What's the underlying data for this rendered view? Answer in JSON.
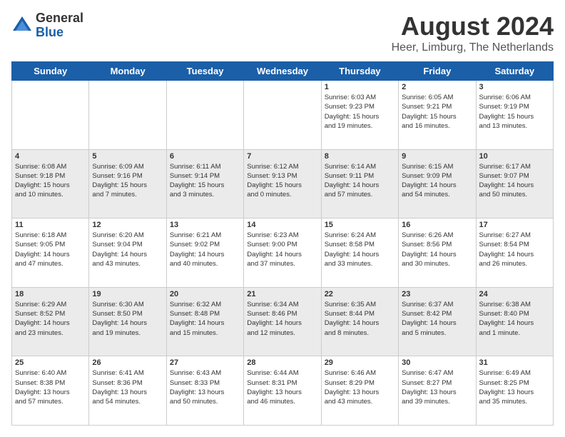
{
  "header": {
    "logo_general": "General",
    "logo_blue": "Blue",
    "month_title": "August 2024",
    "location": "Heer, Limburg, The Netherlands"
  },
  "weekdays": [
    "Sunday",
    "Monday",
    "Tuesday",
    "Wednesday",
    "Thursday",
    "Friday",
    "Saturday"
  ],
  "rows": [
    [
      {
        "day": "",
        "info": ""
      },
      {
        "day": "",
        "info": ""
      },
      {
        "day": "",
        "info": ""
      },
      {
        "day": "",
        "info": ""
      },
      {
        "day": "1",
        "info": "Sunrise: 6:03 AM\nSunset: 9:23 PM\nDaylight: 15 hours\nand 19 minutes."
      },
      {
        "day": "2",
        "info": "Sunrise: 6:05 AM\nSunset: 9:21 PM\nDaylight: 15 hours\nand 16 minutes."
      },
      {
        "day": "3",
        "info": "Sunrise: 6:06 AM\nSunset: 9:19 PM\nDaylight: 15 hours\nand 13 minutes."
      }
    ],
    [
      {
        "day": "4",
        "info": "Sunrise: 6:08 AM\nSunset: 9:18 PM\nDaylight: 15 hours\nand 10 minutes."
      },
      {
        "day": "5",
        "info": "Sunrise: 6:09 AM\nSunset: 9:16 PM\nDaylight: 15 hours\nand 7 minutes."
      },
      {
        "day": "6",
        "info": "Sunrise: 6:11 AM\nSunset: 9:14 PM\nDaylight: 15 hours\nand 3 minutes."
      },
      {
        "day": "7",
        "info": "Sunrise: 6:12 AM\nSunset: 9:13 PM\nDaylight: 15 hours\nand 0 minutes."
      },
      {
        "day": "8",
        "info": "Sunrise: 6:14 AM\nSunset: 9:11 PM\nDaylight: 14 hours\nand 57 minutes."
      },
      {
        "day": "9",
        "info": "Sunrise: 6:15 AM\nSunset: 9:09 PM\nDaylight: 14 hours\nand 54 minutes."
      },
      {
        "day": "10",
        "info": "Sunrise: 6:17 AM\nSunset: 9:07 PM\nDaylight: 14 hours\nand 50 minutes."
      }
    ],
    [
      {
        "day": "11",
        "info": "Sunrise: 6:18 AM\nSunset: 9:05 PM\nDaylight: 14 hours\nand 47 minutes."
      },
      {
        "day": "12",
        "info": "Sunrise: 6:20 AM\nSunset: 9:04 PM\nDaylight: 14 hours\nand 43 minutes."
      },
      {
        "day": "13",
        "info": "Sunrise: 6:21 AM\nSunset: 9:02 PM\nDaylight: 14 hours\nand 40 minutes."
      },
      {
        "day": "14",
        "info": "Sunrise: 6:23 AM\nSunset: 9:00 PM\nDaylight: 14 hours\nand 37 minutes."
      },
      {
        "day": "15",
        "info": "Sunrise: 6:24 AM\nSunset: 8:58 PM\nDaylight: 14 hours\nand 33 minutes."
      },
      {
        "day": "16",
        "info": "Sunrise: 6:26 AM\nSunset: 8:56 PM\nDaylight: 14 hours\nand 30 minutes."
      },
      {
        "day": "17",
        "info": "Sunrise: 6:27 AM\nSunset: 8:54 PM\nDaylight: 14 hours\nand 26 minutes."
      }
    ],
    [
      {
        "day": "18",
        "info": "Sunrise: 6:29 AM\nSunset: 8:52 PM\nDaylight: 14 hours\nand 23 minutes."
      },
      {
        "day": "19",
        "info": "Sunrise: 6:30 AM\nSunset: 8:50 PM\nDaylight: 14 hours\nand 19 minutes."
      },
      {
        "day": "20",
        "info": "Sunrise: 6:32 AM\nSunset: 8:48 PM\nDaylight: 14 hours\nand 15 minutes."
      },
      {
        "day": "21",
        "info": "Sunrise: 6:34 AM\nSunset: 8:46 PM\nDaylight: 14 hours\nand 12 minutes."
      },
      {
        "day": "22",
        "info": "Sunrise: 6:35 AM\nSunset: 8:44 PM\nDaylight: 14 hours\nand 8 minutes."
      },
      {
        "day": "23",
        "info": "Sunrise: 6:37 AM\nSunset: 8:42 PM\nDaylight: 14 hours\nand 5 minutes."
      },
      {
        "day": "24",
        "info": "Sunrise: 6:38 AM\nSunset: 8:40 PM\nDaylight: 14 hours\nand 1 minute."
      }
    ],
    [
      {
        "day": "25",
        "info": "Sunrise: 6:40 AM\nSunset: 8:38 PM\nDaylight: 13 hours\nand 57 minutes."
      },
      {
        "day": "26",
        "info": "Sunrise: 6:41 AM\nSunset: 8:36 PM\nDaylight: 13 hours\nand 54 minutes."
      },
      {
        "day": "27",
        "info": "Sunrise: 6:43 AM\nSunset: 8:33 PM\nDaylight: 13 hours\nand 50 minutes."
      },
      {
        "day": "28",
        "info": "Sunrise: 6:44 AM\nSunset: 8:31 PM\nDaylight: 13 hours\nand 46 minutes."
      },
      {
        "day": "29",
        "info": "Sunrise: 6:46 AM\nSunset: 8:29 PM\nDaylight: 13 hours\nand 43 minutes."
      },
      {
        "day": "30",
        "info": "Sunrise: 6:47 AM\nSunset: 8:27 PM\nDaylight: 13 hours\nand 39 minutes."
      },
      {
        "day": "31",
        "info": "Sunrise: 6:49 AM\nSunset: 8:25 PM\nDaylight: 13 hours\nand 35 minutes."
      }
    ]
  ]
}
